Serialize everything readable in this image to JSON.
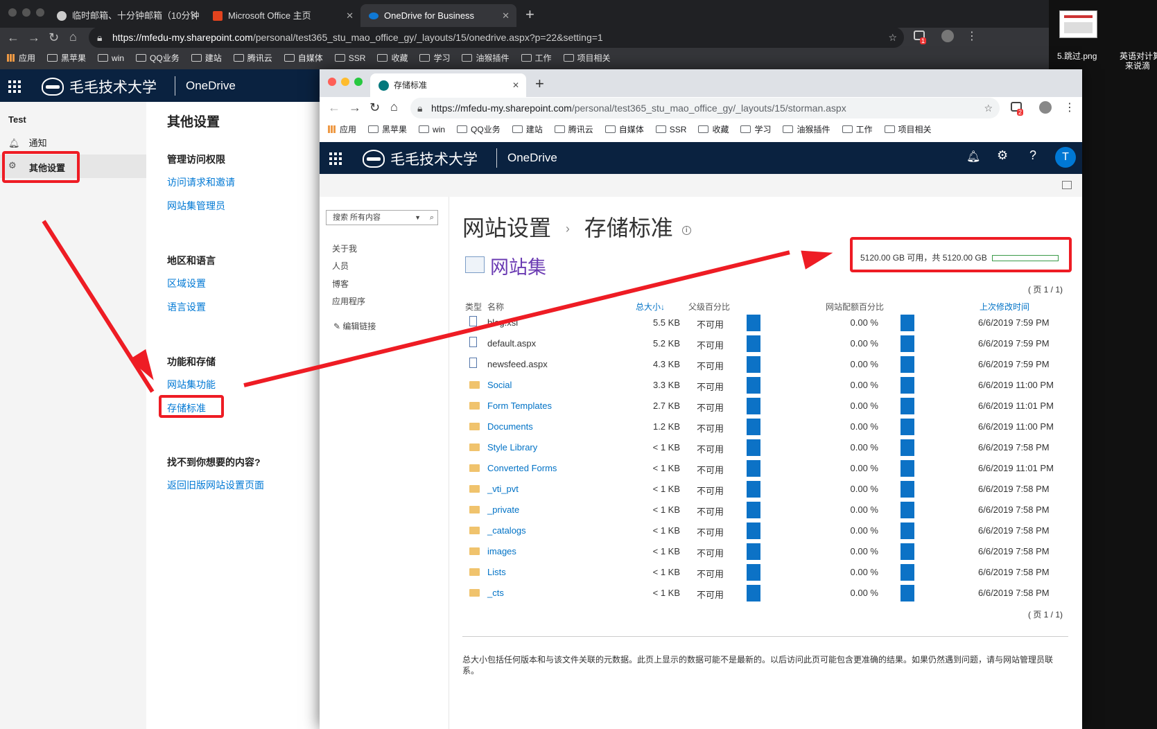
{
  "back_browser": {
    "tabs": [
      {
        "label": "临时邮箱、十分钟邮箱（10分钟"
      },
      {
        "label": "Microsoft Office 主页"
      },
      {
        "label": "OneDrive for Business"
      }
    ],
    "url_host": "https://mfedu-my.sharepoint.com",
    "url_path": "/personal/test365_stu_mao_office_gy/_layouts/15/onedrive.aspx?p=22&setting=1",
    "ext_badge": "1",
    "bookmarks": [
      "应用",
      "黑苹果",
      "win",
      "QQ业务",
      "建站",
      "腾讯云",
      "自媒体",
      "SSR",
      "收藏",
      "学习",
      "油猴插件",
      "工作",
      "项目相关"
    ]
  },
  "suite": {
    "brand": "毛毛技术大学",
    "app": "OneDrive"
  },
  "left_nav": {
    "site_name": "Test",
    "items": [
      {
        "label": "通知",
        "icon": "bell-icon"
      },
      {
        "label": "其他设置",
        "icon": "gear-icon"
      }
    ]
  },
  "settings": {
    "title": "其他设置",
    "sections": [
      {
        "title": "管理访问权限",
        "links": [
          "访问请求和邀请",
          "网站集管理员"
        ]
      },
      {
        "title": "地区和语言",
        "links": [
          "区域设置",
          "语言设置"
        ]
      },
      {
        "title": "功能和存储",
        "links": [
          "网站集功能",
          "存储标准"
        ]
      },
      {
        "title": "找不到你想要的内容?",
        "links": [
          "返回旧版网站设置页面"
        ]
      }
    ]
  },
  "front_browser": {
    "tab_label": "存储标准",
    "url_host": "https://mfedu-my.sharepoint.com",
    "url_path": "/personal/test365_stu_mao_office_gy/_layouts/15/storman.aspx",
    "ext_badge": "2",
    "bookmarks": [
      "应用",
      "黑苹果",
      "win",
      "QQ业务",
      "建站",
      "腾讯云",
      "自媒体",
      "SSR",
      "收藏",
      "学习",
      "油猴插件",
      "工作",
      "项目相关"
    ]
  },
  "sp": {
    "search_placeholder": "搜索 所有内容",
    "quick_launch": [
      "关于我",
      "人员",
      "博客",
      "应用程序"
    ],
    "edit_links": "编辑链接",
    "breadcrumb_root": "网站设置",
    "breadcrumb_sep": "›",
    "page_title": "存储标准",
    "site_collection": "网站集",
    "quota_text": "5120.00 GB 可用，共 5120.00 GB",
    "pager": "( 页 1 / 1)",
    "columns": {
      "type": "类型",
      "name": "名称",
      "size": "总大小↓",
      "parent": "父级百分比",
      "quota": "网站配额百分比",
      "modified": "上次修改时间"
    },
    "rows": [
      {
        "kind": "doc",
        "name": "blog.xsl",
        "size": "5.5 KB",
        "parent": "不可用",
        "quota": "0.00 %",
        "modified": "6/6/2019 7:59 PM"
      },
      {
        "kind": "doc",
        "name": "default.aspx",
        "size": "5.2 KB",
        "parent": "不可用",
        "quota": "0.00 %",
        "modified": "6/6/2019 7:59 PM"
      },
      {
        "kind": "doc",
        "name": "newsfeed.aspx",
        "size": "4.3 KB",
        "parent": "不可用",
        "quota": "0.00 %",
        "modified": "6/6/2019 7:59 PM"
      },
      {
        "kind": "folder",
        "name": "Social",
        "size": "3.3 KB",
        "parent": "不可用",
        "quota": "0.00 %",
        "modified": "6/6/2019 11:00 PM"
      },
      {
        "kind": "folder",
        "name": "Form Templates",
        "size": "2.7 KB",
        "parent": "不可用",
        "quota": "0.00 %",
        "modified": "6/6/2019 11:01 PM"
      },
      {
        "kind": "folder",
        "name": "Documents",
        "size": "1.2 KB",
        "parent": "不可用",
        "quota": "0.00 %",
        "modified": "6/6/2019 11:00 PM"
      },
      {
        "kind": "folder",
        "name": "Style Library",
        "size": "< 1 KB",
        "parent": "不可用",
        "quota": "0.00 %",
        "modified": "6/6/2019 7:58 PM"
      },
      {
        "kind": "folder",
        "name": "Converted Forms",
        "size": "< 1 KB",
        "parent": "不可用",
        "quota": "0.00 %",
        "modified": "6/6/2019 11:01 PM"
      },
      {
        "kind": "folder",
        "name": "_vti_pvt",
        "size": "< 1 KB",
        "parent": "不可用",
        "quota": "0.00 %",
        "modified": "6/6/2019 7:58 PM"
      },
      {
        "kind": "folder",
        "name": "_private",
        "size": "< 1 KB",
        "parent": "不可用",
        "quota": "0.00 %",
        "modified": "6/6/2019 7:58 PM"
      },
      {
        "kind": "folder",
        "name": "_catalogs",
        "size": "< 1 KB",
        "parent": "不可用",
        "quota": "0.00 %",
        "modified": "6/6/2019 7:58 PM"
      },
      {
        "kind": "folder",
        "name": "images",
        "size": "< 1 KB",
        "parent": "不可用",
        "quota": "0.00 %",
        "modified": "6/6/2019 7:58 PM"
      },
      {
        "kind": "folder",
        "name": "Lists",
        "size": "< 1 KB",
        "parent": "不可用",
        "quota": "0.00 %",
        "modified": "6/6/2019 7:58 PM"
      },
      {
        "kind": "folder",
        "name": "_cts",
        "size": "< 1 KB",
        "parent": "不可用",
        "quota": "0.00 %",
        "modified": "6/6/2019 7:58 PM"
      }
    ],
    "footer_note": "总大小包括任何版本和与该文件关联的元数据。此页上显示的数据可能不是最新的。以后访问此页可能包含更准确的结果。如果仍然遇到问题，请与网站管理员联系。"
  },
  "desktop": {
    "file1": "5.跳过.png",
    "file2_line1": "英语对计算",
    "file2_line2": "来说滴"
  },
  "user_initial": "T",
  "colors": {
    "suite_bar": "#0a2240",
    "link": "#0078d4",
    "annotation_red": "#ee1c24",
    "usage_bar": "#0c72c6"
  }
}
